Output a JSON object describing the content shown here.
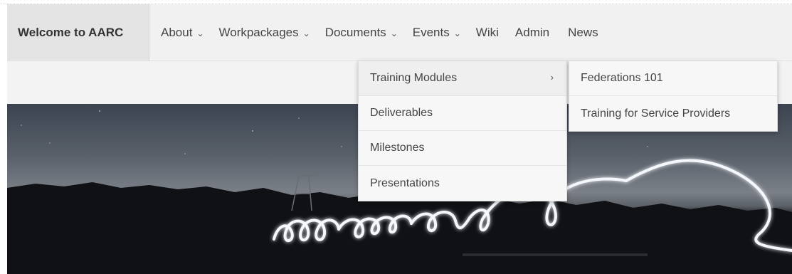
{
  "nav": {
    "brand": "Welcome to AARC",
    "items": [
      {
        "label": "About",
        "dropdown": true
      },
      {
        "label": "Workpackages",
        "dropdown": true
      },
      {
        "label": "Documents",
        "dropdown": true
      },
      {
        "label": "Events",
        "dropdown": true
      },
      {
        "label": "Wiki",
        "dropdown": false
      },
      {
        "label": "Admin",
        "dropdown": false
      },
      {
        "label": "News",
        "dropdown": false
      }
    ],
    "caret_icon": "chevron-down-icon"
  },
  "documents_menu": {
    "items": [
      {
        "label": "Training Modules",
        "has_submenu": true
      },
      {
        "label": "Deliverables"
      },
      {
        "label": "Milestones"
      },
      {
        "label": "Presentations"
      }
    ],
    "arrow_icon": "chevron-right-icon"
  },
  "training_submenu": {
    "items": [
      {
        "label": "Federations 101"
      },
      {
        "label": "Training for Service Providers"
      }
    ]
  },
  "colors": {
    "navbar_bg": "#f1f1f1",
    "brand_bg": "#e4e4e4",
    "menu_bg": "#f7f7f7"
  }
}
